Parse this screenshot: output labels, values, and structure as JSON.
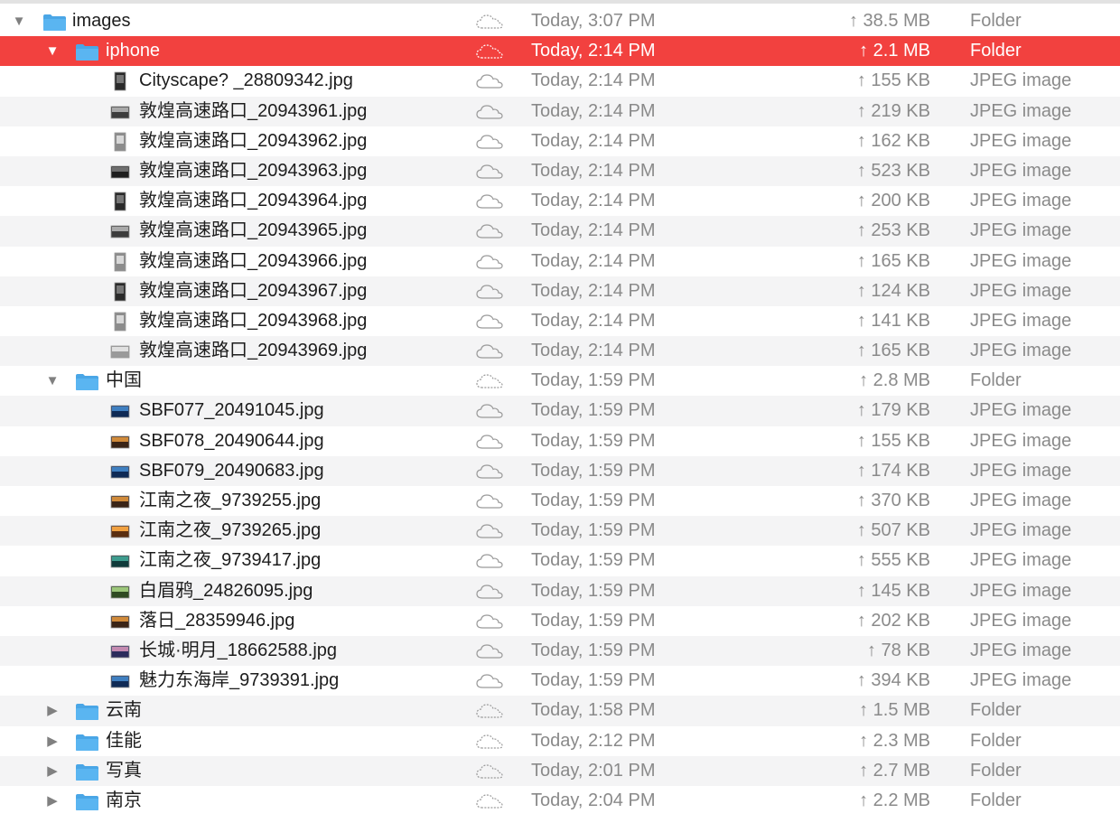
{
  "window": {
    "title": "images"
  },
  "colors": {
    "selection": "#f2413f",
    "folder": "#5ab5f1",
    "secondary_text": "#8a8a8a",
    "zebra": "#f4f4f5"
  },
  "rows": [
    {
      "name": "images",
      "level": 0,
      "kind_type": "folder",
      "disclosure": "expanded",
      "cloud": "dashed",
      "date": "Today, 3:07 PM",
      "size": "↑ 38.5 MB",
      "kind": "Folder"
    },
    {
      "name": "iphone",
      "level": 1,
      "kind_type": "folder",
      "disclosure": "expanded",
      "cloud": "dashed",
      "date": "Today, 2:14 PM",
      "size": "↑ 2.1 MB",
      "kind": "Folder",
      "selected": true
    },
    {
      "name": "Cityscape?  _28809342.jpg",
      "level": 2,
      "kind_type": "file",
      "thumb": "portrait-dark",
      "cloud": "solid",
      "date": "Today, 2:14 PM",
      "size": "↑ 155 KB",
      "kind": "JPEG image"
    },
    {
      "name": "敦煌高速路口_20943961.jpg",
      "level": 2,
      "kind_type": "file",
      "thumb": "landscape-gray",
      "cloud": "solid",
      "date": "Today, 2:14 PM",
      "size": "↑ 219 KB",
      "kind": "JPEG image"
    },
    {
      "name": "敦煌高速路口_20943962.jpg",
      "level": 2,
      "kind_type": "file",
      "thumb": "portrait-light",
      "cloud": "solid",
      "date": "Today, 2:14 PM",
      "size": "↑ 162 KB",
      "kind": "JPEG image"
    },
    {
      "name": "敦煌高速路口_20943963.jpg",
      "level": 2,
      "kind_type": "file",
      "thumb": "landscape-dark",
      "cloud": "solid",
      "date": "Today, 2:14 PM",
      "size": "↑ 523 KB",
      "kind": "JPEG image"
    },
    {
      "name": "敦煌高速路口_20943964.jpg",
      "level": 2,
      "kind_type": "file",
      "thumb": "portrait-dark",
      "cloud": "solid",
      "date": "Today, 2:14 PM",
      "size": "↑ 200 KB",
      "kind": "JPEG image"
    },
    {
      "name": "敦煌高速路口_20943965.jpg",
      "level": 2,
      "kind_type": "file",
      "thumb": "landscape-gray",
      "cloud": "solid",
      "date": "Today, 2:14 PM",
      "size": "↑ 253 KB",
      "kind": "JPEG image"
    },
    {
      "name": "敦煌高速路口_20943966.jpg",
      "level": 2,
      "kind_type": "file",
      "thumb": "portrait-light",
      "cloud": "solid",
      "date": "Today, 2:14 PM",
      "size": "↑ 165 KB",
      "kind": "JPEG image"
    },
    {
      "name": "敦煌高速路口_20943967.jpg",
      "level": 2,
      "kind_type": "file",
      "thumb": "portrait-dark",
      "cloud": "solid",
      "date": "Today, 2:14 PM",
      "size": "↑ 124 KB",
      "kind": "JPEG image"
    },
    {
      "name": "敦煌高速路口_20943968.jpg",
      "level": 2,
      "kind_type": "file",
      "thumb": "portrait-light",
      "cloud": "solid",
      "date": "Today, 2:14 PM",
      "size": "↑ 141 KB",
      "kind": "JPEG image"
    },
    {
      "name": "敦煌高速路口_20943969.jpg",
      "level": 2,
      "kind_type": "file",
      "thumb": "landscape-light",
      "cloud": "solid",
      "date": "Today, 2:14 PM",
      "size": "↑ 165 KB",
      "kind": "JPEG image"
    },
    {
      "name": "中国",
      "level": 1,
      "kind_type": "folder",
      "disclosure": "expanded",
      "cloud": "dashed",
      "date": "Today, 1:59 PM",
      "size": "↑ 2.8 MB",
      "kind": "Folder"
    },
    {
      "name": "SBF077_20491045.jpg",
      "level": 2,
      "kind_type": "file",
      "thumb": "landscape-blue",
      "cloud": "solid",
      "date": "Today, 1:59 PM",
      "size": "↑ 179 KB",
      "kind": "JPEG image"
    },
    {
      "name": "SBF078_20490644.jpg",
      "level": 2,
      "kind_type": "file",
      "thumb": "landscape-warm",
      "cloud": "solid",
      "date": "Today, 1:59 PM",
      "size": "↑ 155 KB",
      "kind": "JPEG image"
    },
    {
      "name": "SBF079_20490683.jpg",
      "level": 2,
      "kind_type": "file",
      "thumb": "landscape-blue",
      "cloud": "solid",
      "date": "Today, 1:59 PM",
      "size": "↑ 174 KB",
      "kind": "JPEG image"
    },
    {
      "name": "江南之夜_9739255.jpg",
      "level": 2,
      "kind_type": "file",
      "thumb": "landscape-warm",
      "cloud": "solid",
      "date": "Today, 1:59 PM",
      "size": "↑ 370 KB",
      "kind": "JPEG image"
    },
    {
      "name": "江南之夜_9739265.jpg",
      "level": 2,
      "kind_type": "file",
      "thumb": "landscape-orange",
      "cloud": "solid",
      "date": "Today, 1:59 PM",
      "size": "↑ 507 KB",
      "kind": "JPEG image"
    },
    {
      "name": "江南之夜_9739417.jpg",
      "level": 2,
      "kind_type": "file",
      "thumb": "landscape-teal",
      "cloud": "solid",
      "date": "Today, 1:59 PM",
      "size": "↑ 555 KB",
      "kind": "JPEG image"
    },
    {
      "name": "白眉鸦_24826095.jpg",
      "level": 2,
      "kind_type": "file",
      "thumb": "landscape-green",
      "cloud": "solid",
      "date": "Today, 1:59 PM",
      "size": "↑ 145 KB",
      "kind": "JPEG image"
    },
    {
      "name": "落日_28359946.jpg",
      "level": 2,
      "kind_type": "file",
      "thumb": "landscape-warm",
      "cloud": "solid",
      "date": "Today, 1:59 PM",
      "size": "↑ 202 KB",
      "kind": "JPEG image"
    },
    {
      "name": "长城·明月_18662588.jpg",
      "level": 2,
      "kind_type": "file",
      "thumb": "landscape-purple",
      "cloud": "solid",
      "date": "Today, 1:59 PM",
      "size": "↑ 78 KB",
      "kind": "JPEG image"
    },
    {
      "name": "魅力东海岸_9739391.jpg",
      "level": 2,
      "kind_type": "file",
      "thumb": "landscape-blue",
      "cloud": "solid",
      "date": "Today, 1:59 PM",
      "size": "↑ 394 KB",
      "kind": "JPEG image"
    },
    {
      "name": "云南",
      "level": 1,
      "kind_type": "folder",
      "disclosure": "collapsed",
      "cloud": "dashed",
      "date": "Today, 1:58 PM",
      "size": "↑ 1.5 MB",
      "kind": "Folder"
    },
    {
      "name": "佳能",
      "level": 1,
      "kind_type": "folder",
      "disclosure": "collapsed",
      "cloud": "dashed",
      "date": "Today, 2:12 PM",
      "size": "↑ 2.3 MB",
      "kind": "Folder"
    },
    {
      "name": "写真",
      "level": 1,
      "kind_type": "folder",
      "disclosure": "collapsed",
      "cloud": "dashed",
      "date": "Today, 2:01 PM",
      "size": "↑ 2.7 MB",
      "kind": "Folder"
    },
    {
      "name": "南京",
      "level": 1,
      "kind_type": "folder",
      "disclosure": "collapsed",
      "cloud": "dashed",
      "date": "Today, 2:04 PM",
      "size": "↑ 2.2 MB",
      "kind": "Folder"
    }
  ]
}
